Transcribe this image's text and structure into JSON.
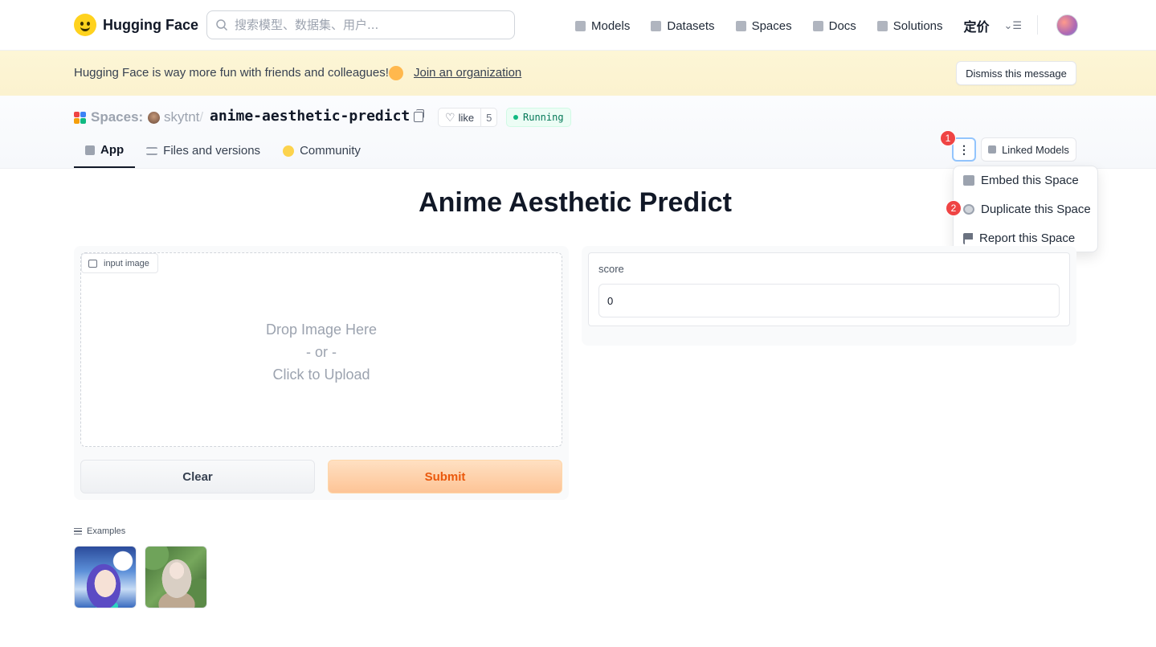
{
  "topnav": {
    "logo_text": "Hugging Face",
    "search_placeholder": "搜索模型、数据集、用户...",
    "links": [
      {
        "label": "Models",
        "icon": "models-icon"
      },
      {
        "label": "Datasets",
        "icon": "datasets-icon"
      },
      {
        "label": "Spaces",
        "icon": "spaces-icon"
      },
      {
        "label": "Docs",
        "icon": "docs-icon"
      },
      {
        "label": "Solutions",
        "icon": "solutions-icon"
      }
    ],
    "pricing_label": "定价"
  },
  "banner": {
    "message": "Hugging Face is way more fun with friends and colleagues!",
    "link_label": "Join an organization",
    "dismiss_label": "Dismiss this message"
  },
  "space": {
    "section_label": "Spaces:",
    "owner": "skytnt",
    "separator": "/",
    "repo_name": "anime-aesthetic-predict",
    "like_label": "like",
    "like_count": "5",
    "status": "Running"
  },
  "tabs": [
    {
      "label": "App",
      "active": true
    },
    {
      "label": "Files and versions",
      "active": false
    },
    {
      "label": "Community",
      "active": false
    }
  ],
  "actions": {
    "linked_models_label": "Linked Models",
    "menu_items": [
      {
        "label": "Embed this Space"
      },
      {
        "label": "Duplicate this Space"
      },
      {
        "label": "Report this Space"
      }
    ],
    "annotation_badges": [
      "1",
      "2"
    ]
  },
  "app": {
    "title": "Anime Aesthetic Predict",
    "input_label": "input image",
    "drop_line1": "Drop Image Here",
    "drop_line2": "- or -",
    "drop_line3": "Click to Upload",
    "clear_label": "Clear",
    "submit_label": "Submit",
    "output_label": "score",
    "output_value": "0",
    "examples_label": "Examples"
  },
  "colors": {
    "accent_orange": "#ea580c",
    "running_green": "#10b981",
    "banner_bg": "#fdf6d6",
    "badge_red": "#ef4444"
  }
}
